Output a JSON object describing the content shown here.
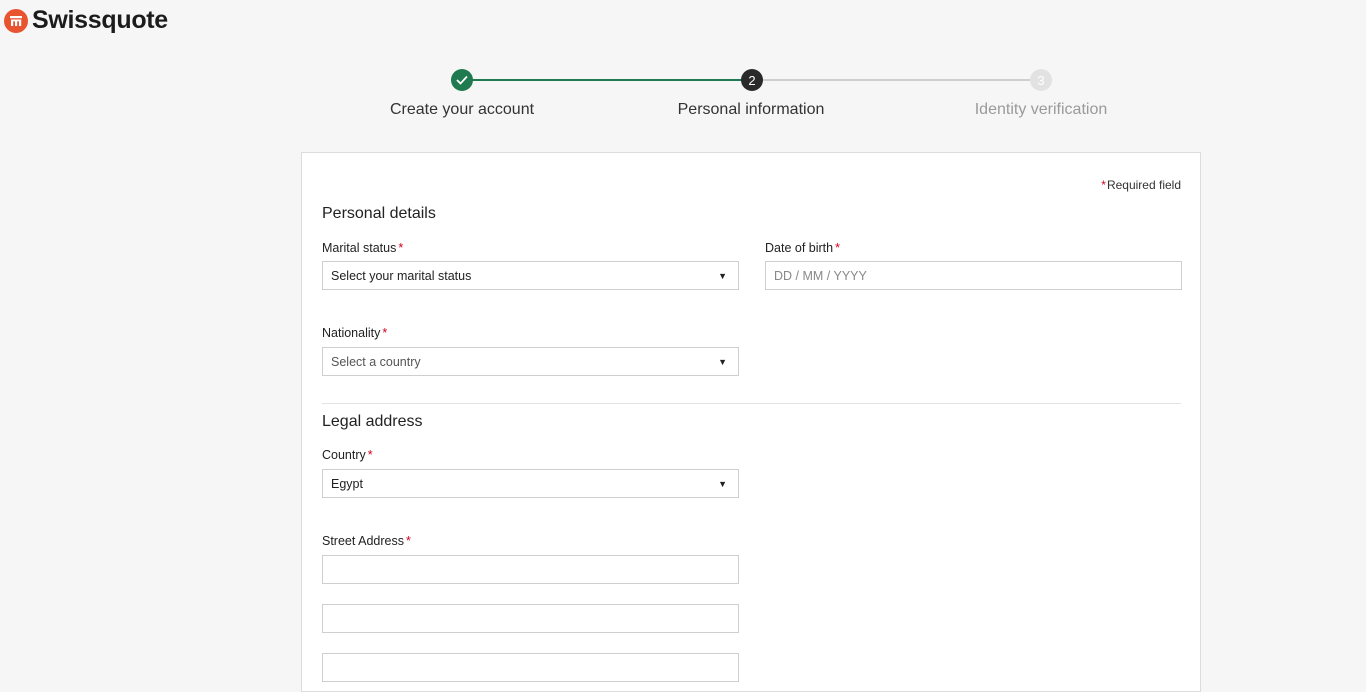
{
  "brand": {
    "name": "Swissquote",
    "logo_icon": "swissquote-logo-icon"
  },
  "stepper": {
    "steps": [
      {
        "label": "Create your account",
        "state": "completed",
        "marker": "✓"
      },
      {
        "label": "Personal information",
        "state": "active",
        "marker": "2"
      },
      {
        "label": "Identity verification",
        "state": "upcoming",
        "marker": "3"
      }
    ]
  },
  "form": {
    "required_note": "Required field",
    "required_marker": "*",
    "personal_details": {
      "title": "Personal details",
      "marital_status": {
        "label": "Marital status",
        "placeholder": "Select your marital status"
      },
      "date_of_birth": {
        "label": "Date of birth",
        "placeholder": "DD / MM / YYYY"
      },
      "nationality": {
        "label": "Nationality",
        "placeholder": "Select a country"
      }
    },
    "legal_address": {
      "title": "Legal address",
      "country": {
        "label": "Country",
        "value": "Egypt"
      },
      "street_address": {
        "label": "Street Address",
        "line1": "",
        "line2": "",
        "line3": ""
      }
    }
  },
  "colors": {
    "brand": "#e8542f",
    "completed": "#1f7a4f",
    "required": "#d0021b"
  }
}
